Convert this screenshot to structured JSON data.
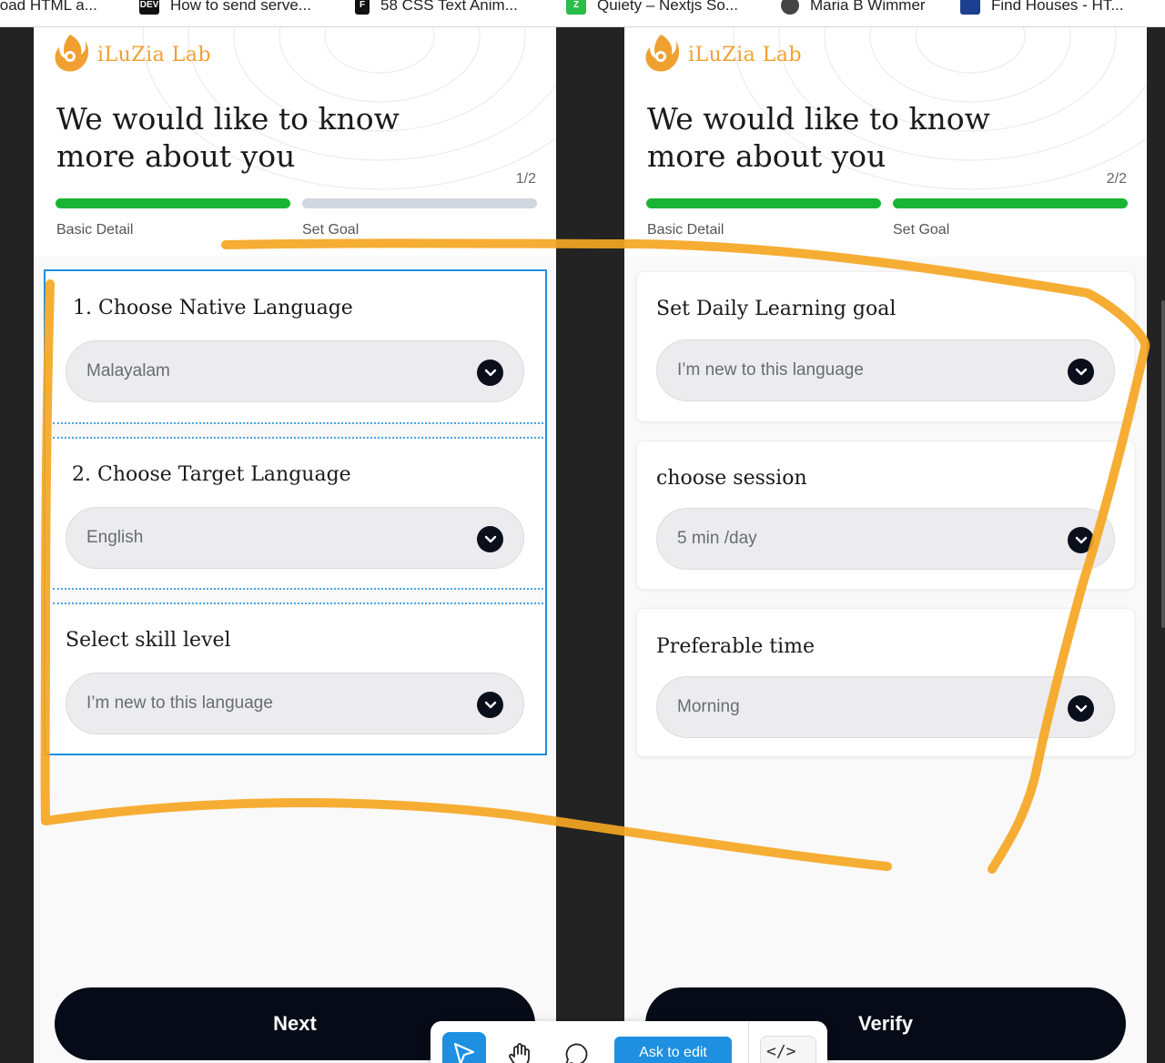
{
  "bookmarks": [
    {
      "label": "load HTML a...",
      "icon": "page-icon"
    },
    {
      "label": "How to send serve...",
      "icon": "dev-icon"
    },
    {
      "label": "58 CSS Text Anim...",
      "icon": "freefrontend-icon"
    },
    {
      "label": "Quiety – Nextjs So...",
      "icon": "quiety-icon"
    },
    {
      "label": "Maria B Wimmer",
      "icon": "avatar-icon"
    },
    {
      "label": "Find Houses - HT...",
      "icon": "houses-icon"
    }
  ],
  "brand": {
    "name": "iLuZia Lab",
    "color": "#f0a030"
  },
  "heading": "We would like to know more about you",
  "steps": {
    "first": "Basic Detail",
    "second": "Set Goal"
  },
  "left_screen": {
    "counter": "1/2",
    "fields": [
      {
        "label": "1. Choose Native Language",
        "value": "Malayalam"
      },
      {
        "label": "2. Choose Target Language",
        "value": "English"
      },
      {
        "label": "Select skill level",
        "value": "I’m new to this language"
      }
    ],
    "button": "Next"
  },
  "right_screen": {
    "counter": "2/2",
    "fields": [
      {
        "label": "Set Daily Learning goal",
        "value": "I’m new to this language"
      },
      {
        "label": "choose session",
        "value": "5 min /day"
      },
      {
        "label": "Preferable time",
        "value": "Morning"
      }
    ],
    "button": "Verify"
  },
  "toolbar": {
    "ask_label": "Ask to edit",
    "code_icon": "</>"
  },
  "colors": {
    "progress_done": "#1ab434",
    "progress_todo": "#d1d7de",
    "selection": "#1e8fe1",
    "annotation": "#f5a623",
    "button": "#070b18"
  }
}
